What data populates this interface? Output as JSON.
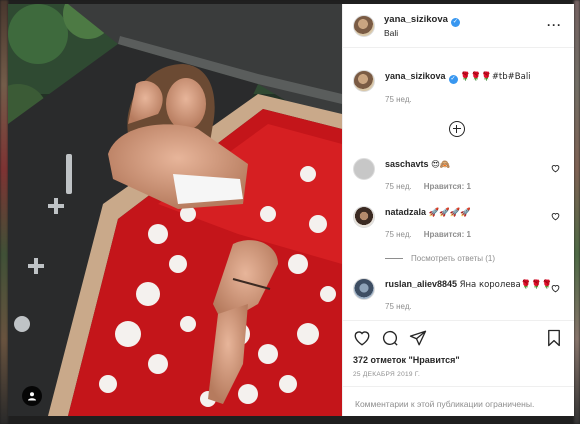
{
  "post": {
    "username": "yana_sizikova",
    "location": "Bali",
    "caption_user": "yana_sizikova",
    "caption_text": "🌹🌹🌹#tb#Bali",
    "caption_time": "75 нед.",
    "likes": "372 отметок \"Нравится\"",
    "date": "25 ДЕКАБРЯ 2019 Г.",
    "comments_limited": "Комментарии к этой публикации ограничены."
  },
  "comments": [
    {
      "user": "saschavts",
      "text": "😍🙈",
      "time": "75 нед.",
      "likes": "Нравится: 1"
    },
    {
      "user": "natadzala",
      "text": "🚀🚀🚀🚀",
      "time": "75 нед.",
      "likes": "Нравится: 1",
      "replies": "Посмотреть ответы (1)"
    },
    {
      "user": "ruslan_aliev8845",
      "text": "Яна королева🌹🌹🌹",
      "time": "75 нед."
    }
  ],
  "icons": {
    "more": "more-options-icon",
    "verified": "verified-badge-icon",
    "like": "heart-icon",
    "comment": "comment-icon",
    "share": "share-icon",
    "save": "bookmark-icon",
    "load_more": "plus-circle-icon",
    "tagged": "user-tag-icon"
  }
}
